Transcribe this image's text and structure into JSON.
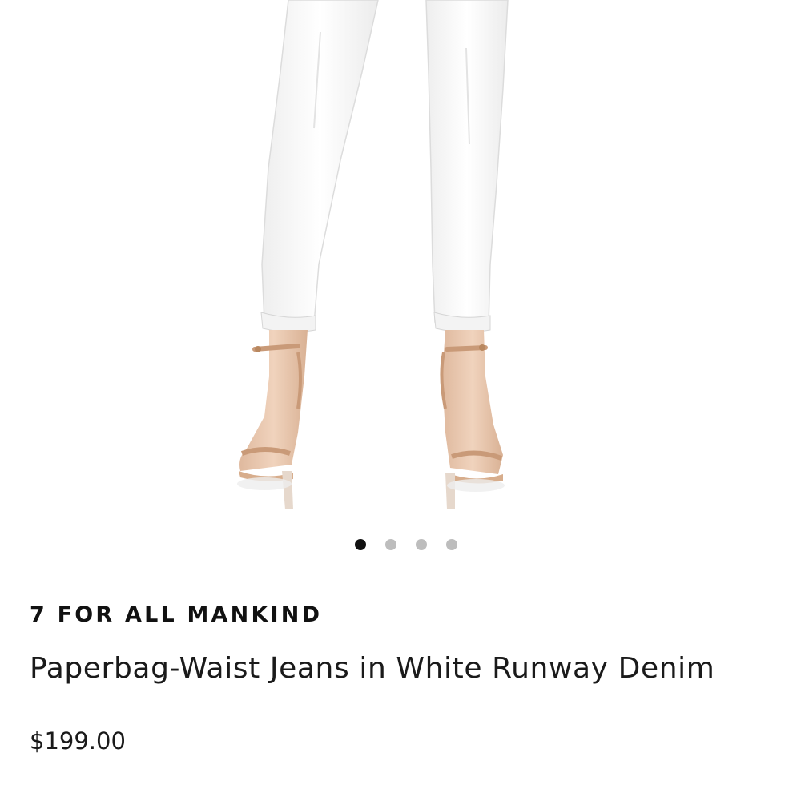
{
  "product": {
    "brand": "7 FOR ALL MANKIND",
    "name": "Paperbag-Waist Jeans in White Runway Denim",
    "price": "$199.00"
  },
  "gallery": {
    "total_images": 4,
    "active_index": 0,
    "image_icon": "product-photo-white-jeans-nude-sandals"
  },
  "colors": {
    "dot_active": "#111111",
    "dot_inactive": "#bdbdbd",
    "jeans": "#fbfbfb",
    "skin": "#e9c7ad",
    "sandal": "#d7ad8c"
  }
}
